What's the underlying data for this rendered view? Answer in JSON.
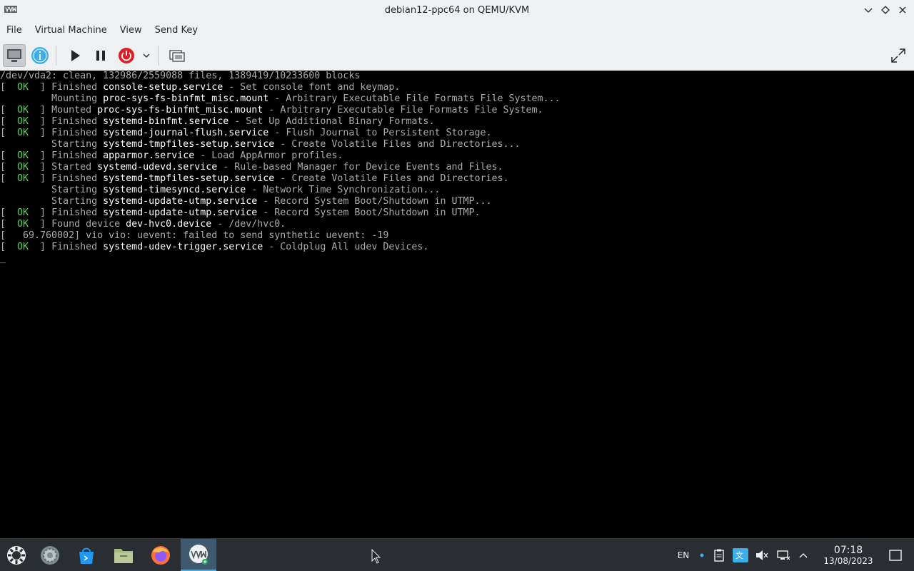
{
  "window": {
    "title": "debian12-ppc64 on QEMU/KVM"
  },
  "menubar": {
    "items": [
      "File",
      "Virtual Machine",
      "View",
      "Send Key"
    ]
  },
  "toolbar": {
    "buttons": [
      "console-view",
      "details-info",
      "run",
      "pause",
      "shutdown",
      "shutdown-menu",
      "screenshot"
    ],
    "fullscreen": "fullscreen"
  },
  "console": {
    "lines": [
      [
        {
          "t": "/dev/vda2: clean, 132986/2559088 files, 1389419/10233600 blocks"
        }
      ],
      [
        {
          "t": "[  "
        },
        {
          "t": "OK",
          "c": "ok"
        },
        {
          "t": "  ] Finished "
        },
        {
          "t": "console-setup.service",
          "c": "hl"
        },
        {
          "t": " - Set console font and keymap."
        }
      ],
      [
        {
          "t": "         Mounting "
        },
        {
          "t": "proc-sys-fs-binfmt_misc.mount",
          "c": "hl"
        },
        {
          "t": " - Arbitrary Executable File Formats File System..."
        }
      ],
      [
        {
          "t": "[  "
        },
        {
          "t": "OK",
          "c": "ok"
        },
        {
          "t": "  ] Mounted "
        },
        {
          "t": "proc-sys-fs-binfmt_misc.mount",
          "c": "hl"
        },
        {
          "t": " - Arbitrary Executable File Formats File System."
        }
      ],
      [
        {
          "t": "[  "
        },
        {
          "t": "OK",
          "c": "ok"
        },
        {
          "t": "  ] Finished "
        },
        {
          "t": "systemd-binfmt.service",
          "c": "hl"
        },
        {
          "t": " - Set Up Additional Binary Formats."
        }
      ],
      [
        {
          "t": "[  "
        },
        {
          "t": "OK",
          "c": "ok"
        },
        {
          "t": "  ] Finished "
        },
        {
          "t": "systemd-journal-flush.service",
          "c": "hl"
        },
        {
          "t": " - Flush Journal to Persistent Storage."
        }
      ],
      [
        {
          "t": "         Starting "
        },
        {
          "t": "systemd-tmpfiles-setup.service",
          "c": "hl"
        },
        {
          "t": " - Create Volatile Files and Directories..."
        }
      ],
      [
        {
          "t": "[  "
        },
        {
          "t": "OK",
          "c": "ok"
        },
        {
          "t": "  ] Finished "
        },
        {
          "t": "apparmor.service",
          "c": "hl"
        },
        {
          "t": " - Load AppArmor profiles."
        }
      ],
      [
        {
          "t": "[  "
        },
        {
          "t": "OK",
          "c": "ok"
        },
        {
          "t": "  ] Started "
        },
        {
          "t": "systemd-udevd.service",
          "c": "hl"
        },
        {
          "t": " - Rule-based Manager for Device Events and Files."
        }
      ],
      [
        {
          "t": "[  "
        },
        {
          "t": "OK",
          "c": "ok"
        },
        {
          "t": "  ] Finished "
        },
        {
          "t": "systemd-tmpfiles-setup.service",
          "c": "hl"
        },
        {
          "t": " - Create Volatile Files and Directories."
        }
      ],
      [
        {
          "t": "         Starting "
        },
        {
          "t": "systemd-timesyncd.service",
          "c": "hl"
        },
        {
          "t": " - Network Time Synchronization..."
        }
      ],
      [
        {
          "t": "         Starting "
        },
        {
          "t": "systemd-update-utmp.service",
          "c": "hl"
        },
        {
          "t": " - Record System Boot/Shutdown in UTMP..."
        }
      ],
      [
        {
          "t": "[  "
        },
        {
          "t": "OK",
          "c": "ok"
        },
        {
          "t": "  ] Finished "
        },
        {
          "t": "systemd-update-utmp.service",
          "c": "hl"
        },
        {
          "t": " - Record System Boot/Shutdown in UTMP."
        }
      ],
      [
        {
          "t": "[  "
        },
        {
          "t": "OK",
          "c": "ok"
        },
        {
          "t": "  ] Found device "
        },
        {
          "t": "dev-hvc0.device",
          "c": "hl"
        },
        {
          "t": " - /dev/hvc0."
        }
      ],
      [
        {
          "t": "[   69.760002] vio vio: uevent: failed to send synthetic uevent: -19"
        }
      ],
      [
        {
          "t": "[  "
        },
        {
          "t": "OK",
          "c": "ok"
        },
        {
          "t": "  ] Finished "
        },
        {
          "t": "systemd-udev-trigger.service",
          "c": "hl"
        },
        {
          "t": " - Coldplug All udev Devices."
        }
      ],
      [
        {
          "t": "_",
          "c": "cursor"
        }
      ]
    ]
  },
  "taskbar": {
    "apps": [
      "application-launcher",
      "system-settings",
      "discover-store",
      "file-manager",
      "firefox",
      "virt-manager"
    ],
    "tray": {
      "keyboard_layout": "EN"
    },
    "clock": {
      "time": "07:18",
      "date": "13/08/2023"
    }
  },
  "colors": {
    "chrome_bg": "#eff0f1",
    "console_bg": "#000000",
    "console_fg": "#aaaaaa",
    "ok_green": "#55d655",
    "taskbar_bg": "#2a2e32",
    "accent": "#3daee9"
  }
}
